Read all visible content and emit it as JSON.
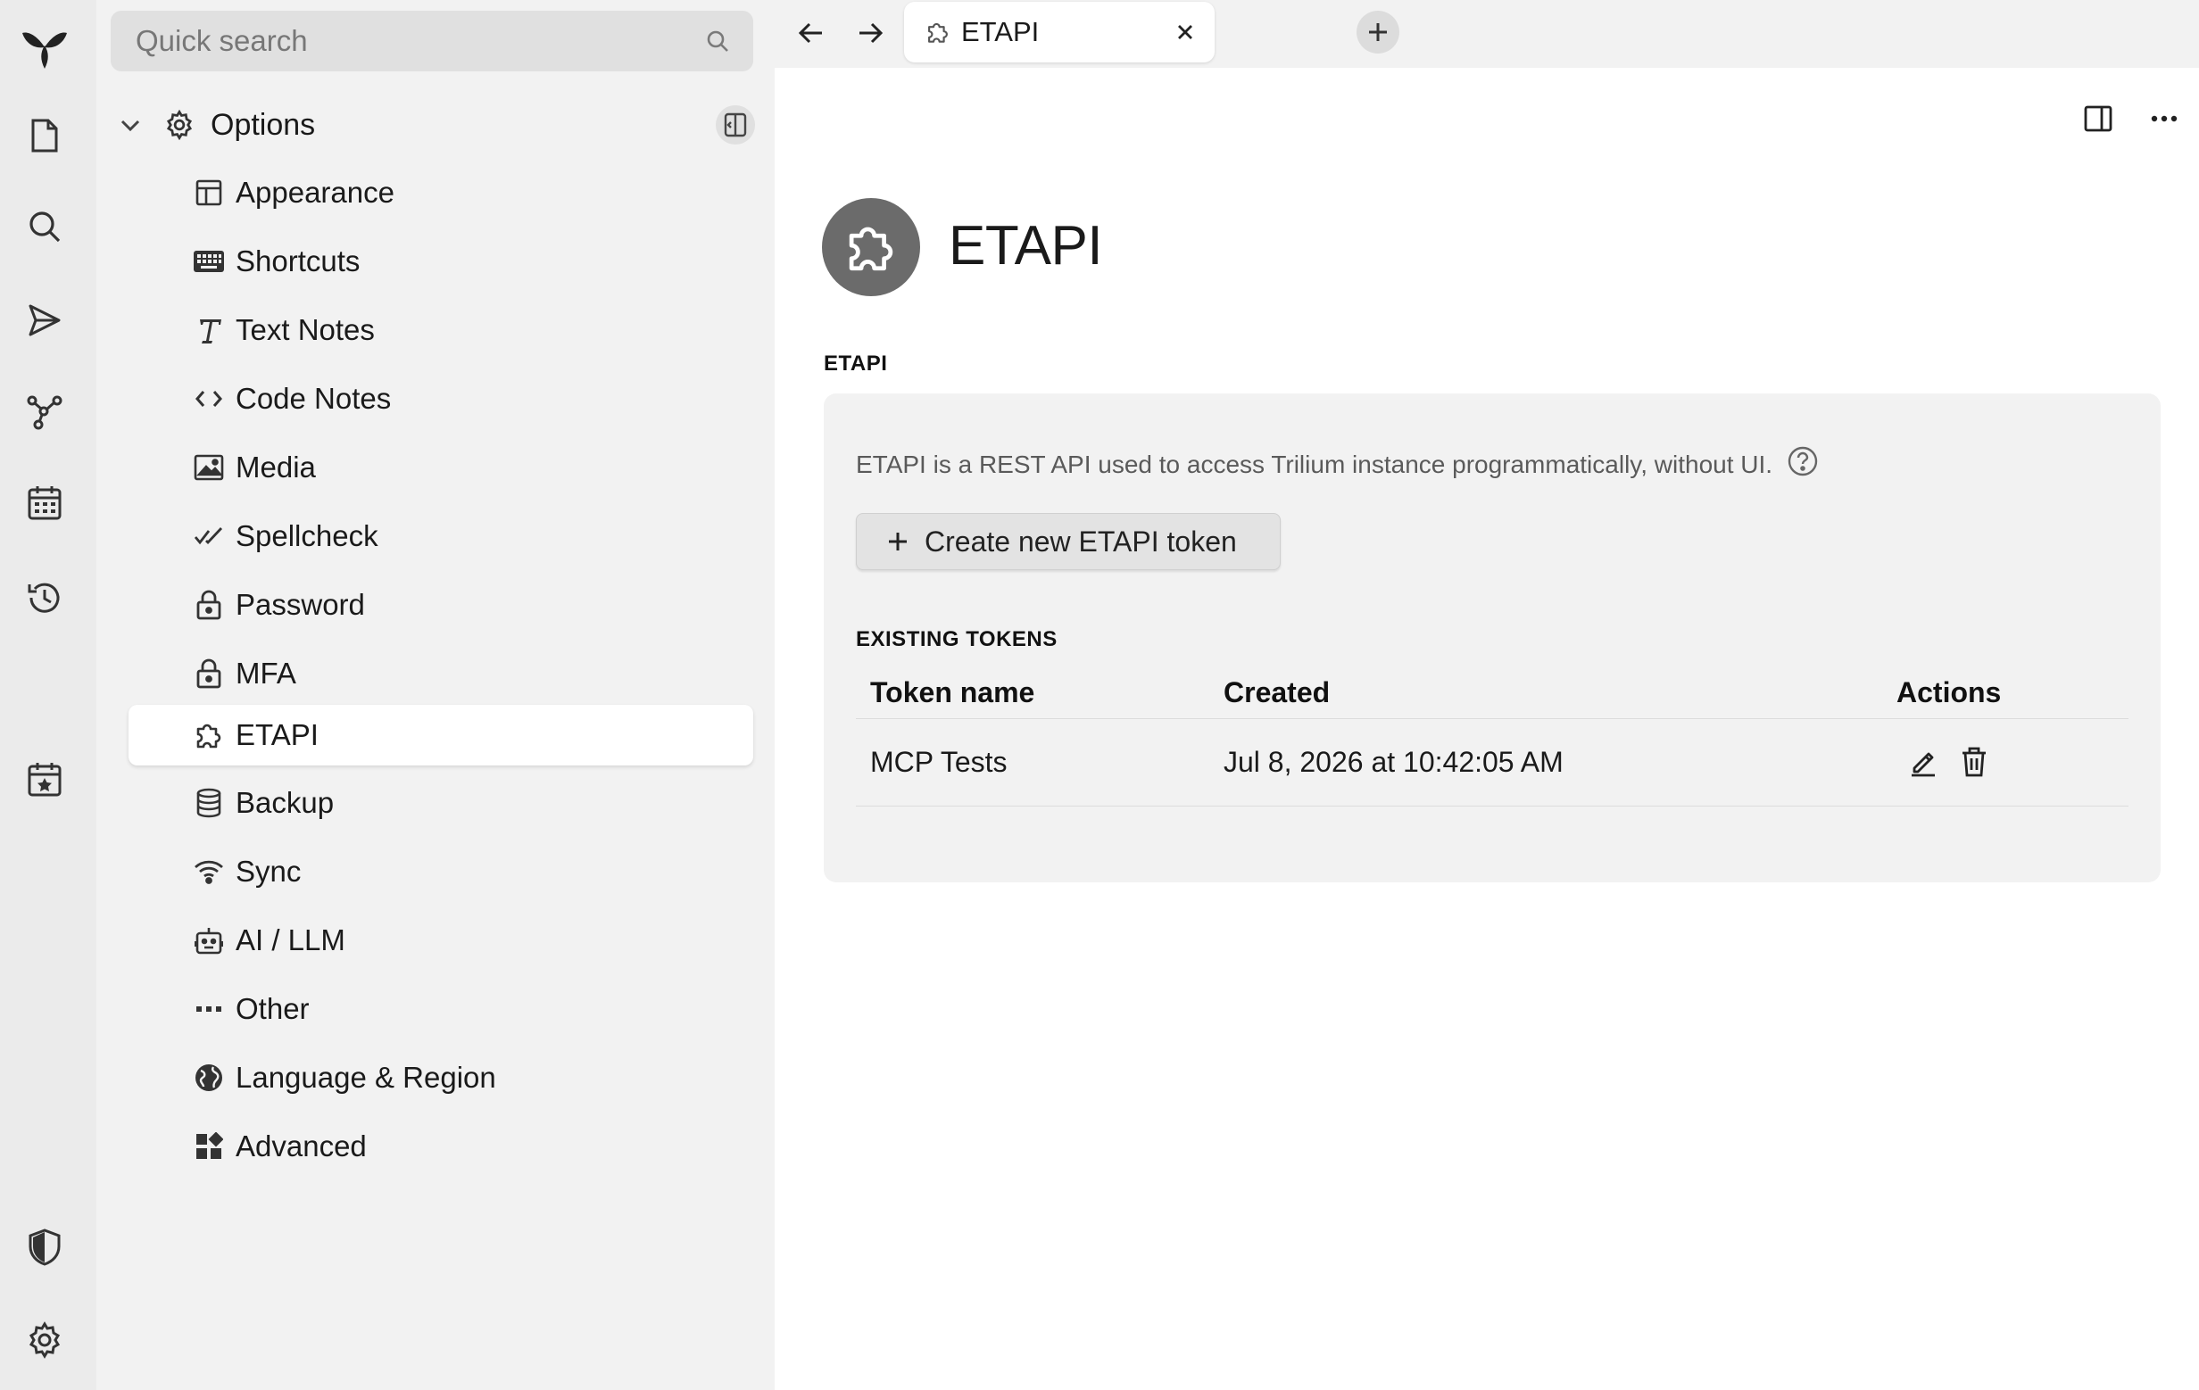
{
  "app": {
    "launcher": [
      "logo-icon",
      "new-note-icon",
      "search-icon",
      "send-icon",
      "graph-icon",
      "calendar-icon",
      "history-icon",
      "today-icon",
      "shield-icon",
      "settings-icon"
    ]
  },
  "tree": {
    "search_placeholder": "Quick search",
    "root_label": "Options",
    "items": [
      {
        "label": "Appearance",
        "icon": "layout-icon"
      },
      {
        "label": "Shortcuts",
        "icon": "keyboard-icon"
      },
      {
        "label": "Text Notes",
        "icon": "italic-t-icon"
      },
      {
        "label": "Code Notes",
        "icon": "code-brackets-icon"
      },
      {
        "label": "Media",
        "icon": "image-icon"
      },
      {
        "label": "Spellcheck",
        "icon": "double-check-icon"
      },
      {
        "label": "Password",
        "icon": "lock-icon"
      },
      {
        "label": "MFA",
        "icon": "lock-icon"
      },
      {
        "label": "ETAPI",
        "icon": "puzzle-icon",
        "active": true
      },
      {
        "label": "Backup",
        "icon": "database-icon"
      },
      {
        "label": "Sync",
        "icon": "wifi-icon"
      },
      {
        "label": "AI / LLM",
        "icon": "robot-icon"
      },
      {
        "label": "Other",
        "icon": "dots-icon"
      },
      {
        "label": "Language & Region",
        "icon": "globe-icon"
      },
      {
        "label": "Advanced",
        "icon": "widgets-icon"
      }
    ]
  },
  "tabs": {
    "active_title": "ETAPI"
  },
  "note": {
    "title": "ETAPI",
    "section_title": "ETAPI",
    "description": "ETAPI is a REST API used to access Trilium instance programmatically, without UI.",
    "create_button_label": "Create new ETAPI token",
    "existing_tokens_label": "EXISTING TOKENS",
    "table": {
      "headers": [
        "Token name",
        "Created",
        "Actions"
      ],
      "rows": [
        {
          "name": "MCP Tests",
          "created": "Jul 8, 2026 at 10:42:05 AM"
        }
      ]
    }
  },
  "colors": {
    "launcher_bg": "#ebebeb",
    "panel_bg": "#f2f2f2",
    "card_bg": "#f2f2f2",
    "note_icon_bg": "#6b6b6b"
  }
}
